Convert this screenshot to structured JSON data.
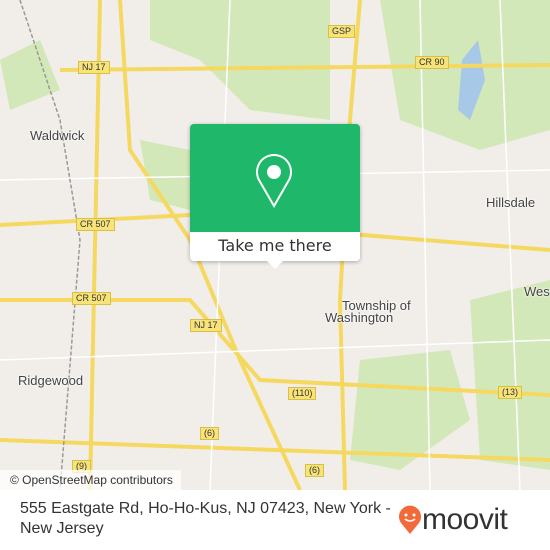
{
  "map": {
    "places": [
      "Waldwick",
      "Hillsdale",
      "Township of",
      "Washington",
      "Ridgewood",
      "Wes"
    ],
    "shields": [
      "NJ 17",
      "GSP",
      "CR 90",
      "CR 507",
      "CR 507",
      "NJ 17",
      "(110)",
      "(6)",
      "(13)",
      "(9)",
      "(6)"
    ],
    "attribution": "© OpenStreetMap contributors",
    "colors": {
      "park": "#cfe6b0",
      "road": "#f5d860",
      "water": "#a8c8e8",
      "land": "#f1eeea"
    }
  },
  "popup": {
    "button_label": "Take me there",
    "icon": "location-pin-icon",
    "color": "#1fb86b"
  },
  "footer": {
    "address": "555 Eastgate Rd, Ho-Ho-Kus, NJ 07423, New York - New Jersey",
    "brand": "moovit",
    "brand_color": "#f26a3a"
  }
}
